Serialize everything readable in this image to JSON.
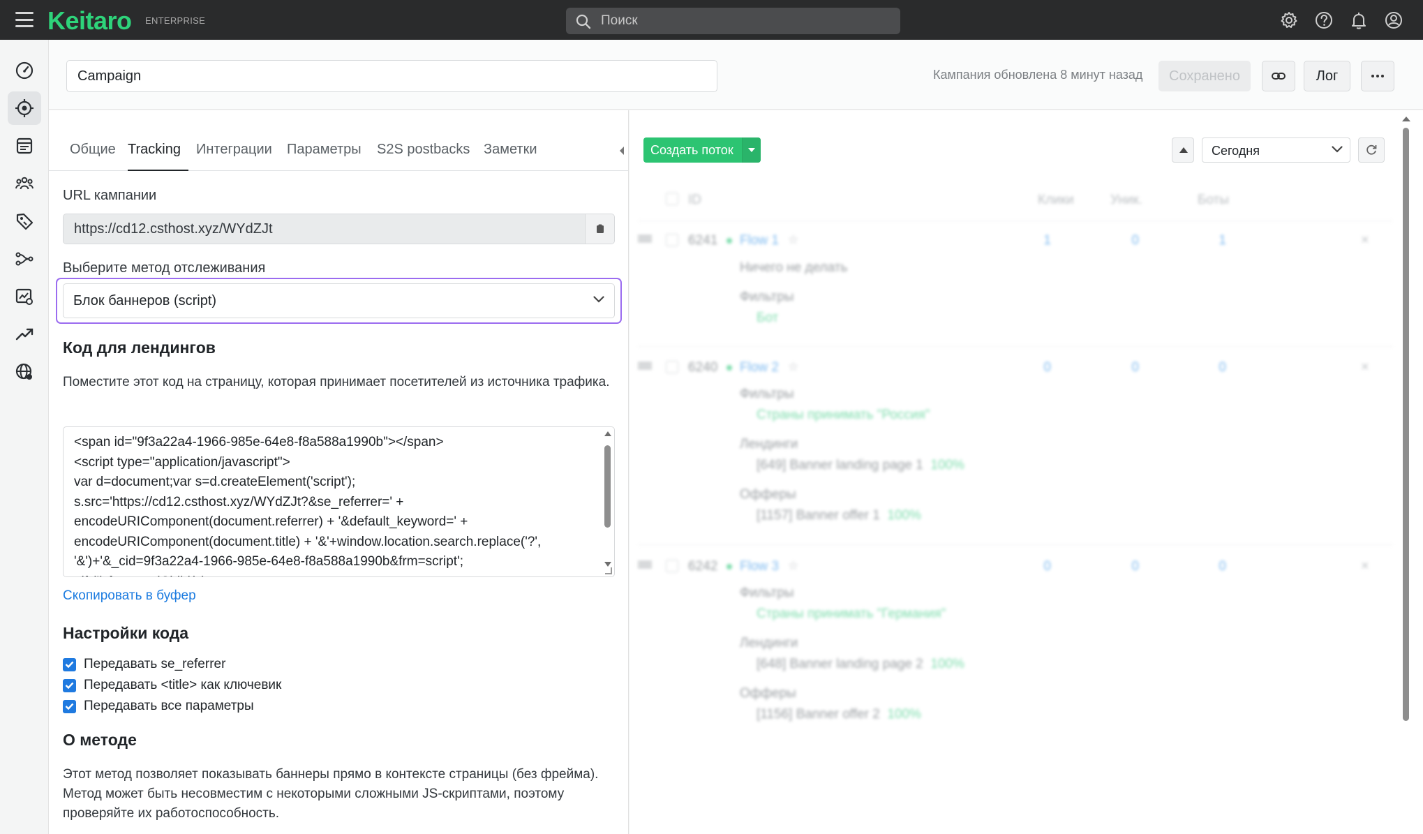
{
  "app": {
    "logo": "Keitaro",
    "edition": "ENTERPRISE",
    "search_placeholder": "Поиск"
  },
  "header": {
    "campaign_name": "Campaign",
    "updated_text": "Кампания обновлена 8 минут назад",
    "saved_label": "Сохранено",
    "log_label": "Лог"
  },
  "tabs": [
    "Общие",
    "Tracking",
    "Интеграции",
    "Параметры",
    "S2S postbacks",
    "Заметки"
  ],
  "tracking": {
    "url_label": "URL кампании",
    "url_value": "https://cd12.csthost.xyz/WYdZJt",
    "method_label": "Выберите метод отслеживания",
    "method_value": "Блок баннеров (script)",
    "code_heading": "Код для лендингов",
    "code_desc": "Поместите этот код на страницу, которая принимает посетителей из источника трафика.",
    "code_lines": [
      "<span id=\"9f3a22a4-1966-985e-64e8-f8a588a1990b\"></span>",
      "<script type=\"application/javascript\">",
      "var d=document;var s=d.createElement('script');",
      "s.src='https://cd12.csthost.xyz/WYdZJt?&se_referrer=' +",
      "encodeURIComponent(document.referrer) + '&default_keyword=' +",
      "encodeURIComponent(document.title) + '&'+window.location.search.replace('?',",
      "'&')+'&_cid=9f3a22a4-1966-985e-64e8-f8a588a1990b&frm=script';",
      "  if (!) { appendChild(s);"
    ],
    "copy_link": "Скопировать в буфер",
    "settings_heading": "Настройки кода",
    "settings": [
      {
        "label": "Передавать se_referrer",
        "checked": true
      },
      {
        "label": "Передавать <title> как ключевик",
        "checked": true
      },
      {
        "label": "Передавать все параметры",
        "checked": true
      }
    ],
    "about_heading": "О методе",
    "about_text": "Этот метод позволяет показывать баннеры прямо в контексте страницы (без фрейма). Метод может быть несовместим с некоторыми сложными JS-скриптами, поэтому проверяйте их работоспособность."
  },
  "flows_panel": {
    "create_label": "Создать поток",
    "date_value": "Сегодня",
    "columns": {
      "id": "ID",
      "clicks": "Клики",
      "unique": "Уник.",
      "bots": "Боты"
    },
    "flows": [
      {
        "id": "6241",
        "name": "Flow 1",
        "clicks": "1",
        "unique": "0",
        "bots": "1",
        "action": "Ничего не делать",
        "filters_label": "Фильтры",
        "filter": "Бот"
      },
      {
        "id": "6240",
        "name": "Flow 2",
        "clicks": "0",
        "unique": "0",
        "bots": "0",
        "filters_label": "Фильтры",
        "filter": "Страны принимать \"Россия\"",
        "landings_label": "Лендинги",
        "landing": "[649] Banner landing page 1",
        "landing_pct": "100%",
        "offers_label": "Офферы",
        "offer": "[1157] Banner offer 1",
        "offer_pct": "100%"
      },
      {
        "id": "6242",
        "name": "Flow 3",
        "clicks": "0",
        "unique": "0",
        "bots": "0",
        "filters_label": "Фильтры",
        "filter": "Страны принимать \"Германия\"",
        "landings_label": "Лендинги",
        "landing": "[648] Banner landing page 2",
        "landing_pct": "100%",
        "offers_label": "Офферы",
        "offer": "[1156] Banner offer 2",
        "offer_pct": "100%"
      }
    ]
  }
}
